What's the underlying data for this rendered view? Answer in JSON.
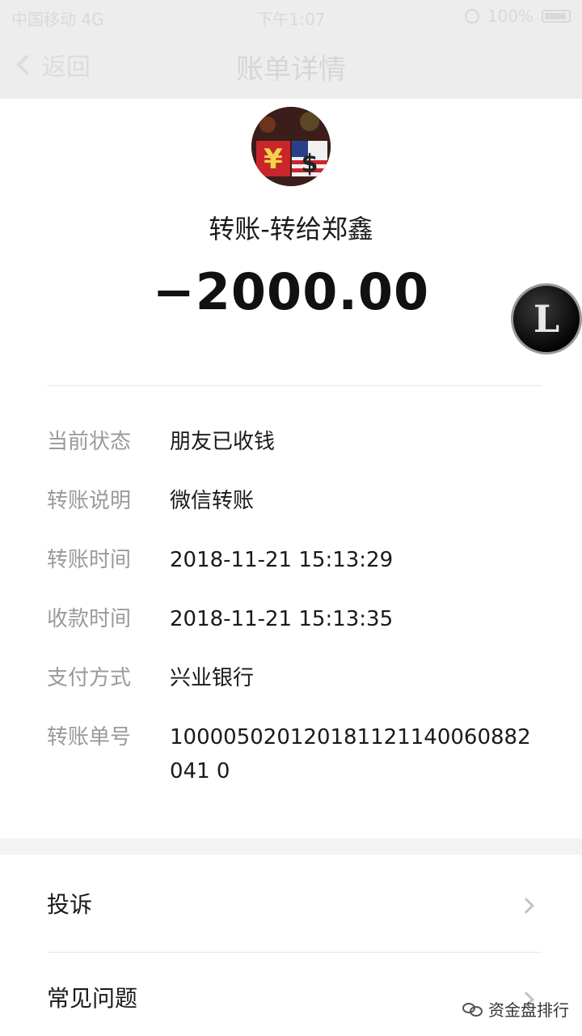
{
  "status_bar": {
    "carrier": "中国移动 4G",
    "time": "下午1:07",
    "battery": "100%"
  },
  "nav": {
    "back_label": "返回",
    "title": "账单详情"
  },
  "header": {
    "avatar_icon": "currency-avatar-icon",
    "transfer_title": "转账-转给郑鑫",
    "amount": "−2000.00",
    "badge_letter": "L"
  },
  "details": [
    {
      "label": "当前状态",
      "value": "朋友已收钱"
    },
    {
      "label": "转账说明",
      "value": "微信转账"
    },
    {
      "label": "转账时间",
      "value": "2018-11-21 15:13:29"
    },
    {
      "label": "收款时间",
      "value": "2018-11-21 15:13:35"
    },
    {
      "label": "支付方式",
      "value": "兴业银行"
    },
    {
      "label": "转账单号",
      "value": "100005020120181121140060882041 0"
    }
  ],
  "menu": [
    {
      "label": "投诉"
    },
    {
      "label": "常见问题"
    }
  ],
  "watermark": {
    "text": "资金盘排行"
  },
  "colors": {
    "nav_bg": "#ededed",
    "label_gray": "#9a9a9a",
    "text_dark": "#1a1a1a"
  }
}
